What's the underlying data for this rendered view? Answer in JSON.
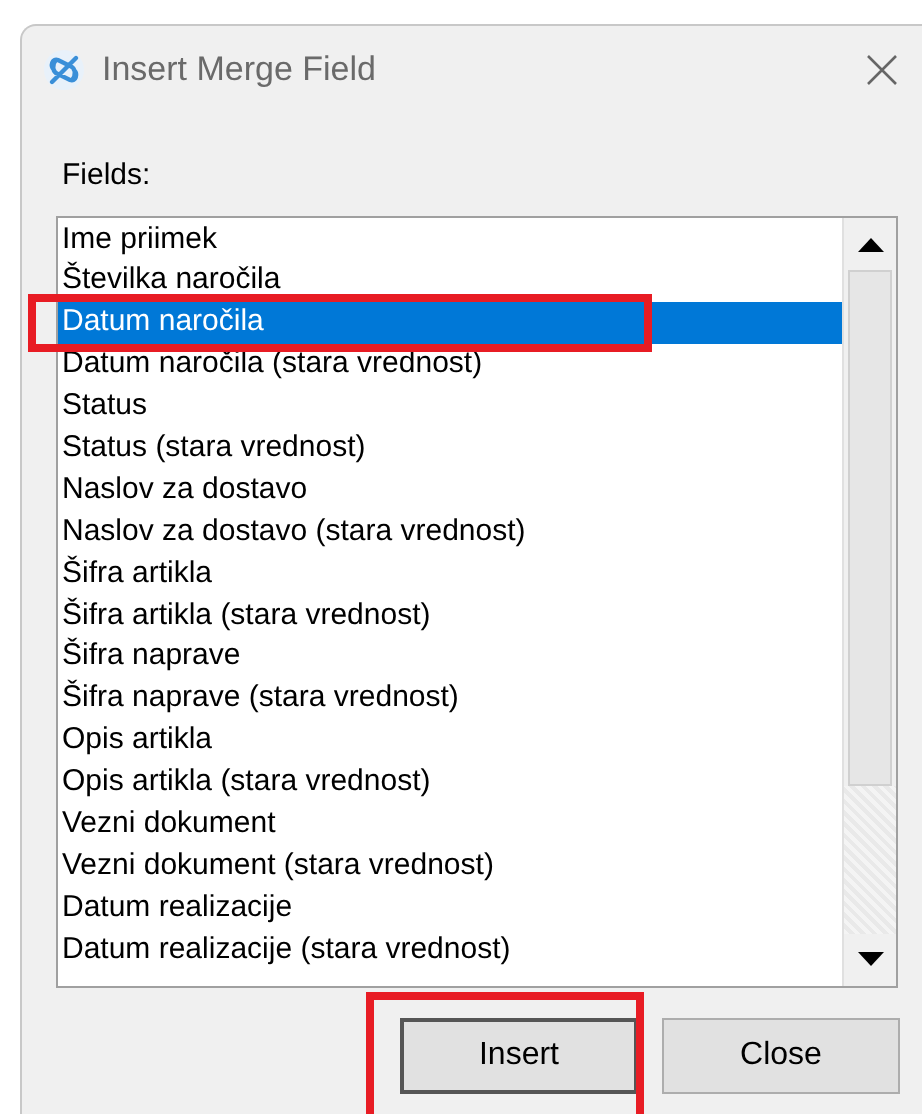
{
  "window": {
    "title": "Insert Merge Field"
  },
  "fields_label": "Fields:",
  "fields": [
    {
      "label": "Ime priimek",
      "selected": false,
      "highlighted": false
    },
    {
      "label": "Številka naročila",
      "selected": false,
      "highlighted": false
    },
    {
      "label": "Datum naročila",
      "selected": true,
      "highlighted": true
    },
    {
      "label": "Datum naročila (stara vrednost)",
      "selected": false,
      "highlighted": false
    },
    {
      "label": "Status",
      "selected": false,
      "highlighted": false
    },
    {
      "label": "Status (stara vrednost)",
      "selected": false,
      "highlighted": false
    },
    {
      "label": "Naslov za dostavo",
      "selected": false,
      "highlighted": false
    },
    {
      "label": "Naslov za dostavo (stara vrednost)",
      "selected": false,
      "highlighted": false
    },
    {
      "label": "Šifra artikla",
      "selected": false,
      "highlighted": false
    },
    {
      "label": "Šifra artikla (stara vrednost)",
      "selected": false,
      "highlighted": false
    },
    {
      "label": "Šifra naprave",
      "selected": false,
      "highlighted": false
    },
    {
      "label": "Šifra naprave (stara vrednost)",
      "selected": false,
      "highlighted": false
    },
    {
      "label": "Opis artikla",
      "selected": false,
      "highlighted": false
    },
    {
      "label": "Opis artikla (stara vrednost)",
      "selected": false,
      "highlighted": false
    },
    {
      "label": "Vezni dokument",
      "selected": false,
      "highlighted": false
    },
    {
      "label": "Vezni dokument (stara vrednost)",
      "selected": false,
      "highlighted": false
    },
    {
      "label": "Datum realizacije",
      "selected": false,
      "highlighted": false
    },
    {
      "label": "Datum realizacije (stara vrednost)",
      "selected": false,
      "highlighted": false
    }
  ],
  "buttons": [
    {
      "label": "Insert",
      "default": true,
      "highlighted": true
    },
    {
      "label": "Close",
      "default": false,
      "highlighted": false
    }
  ]
}
